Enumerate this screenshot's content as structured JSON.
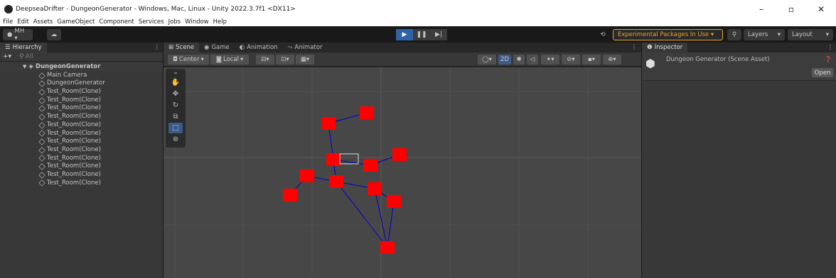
{
  "window": {
    "title": "DeepseaDrifter - DungeonGenerator - Windows, Mac, Linux - Unity 2022.3.7f1 <DX11>",
    "minimize": "–",
    "maximize": "▫",
    "close": "✕"
  },
  "menu": [
    "File",
    "Edit",
    "Assets",
    "GameObject",
    "Component",
    "Services",
    "Jobs",
    "Window",
    "Help"
  ],
  "toolbar": {
    "account": "MH ▾",
    "play": "▶",
    "pause": "❚❚",
    "step": "▶|",
    "experimental": "Experimental Packages In Use ▾",
    "layers": "Layers",
    "layout": "Layout"
  },
  "hierarchy": {
    "tab": "Hierarchy",
    "search_placeholder": "All",
    "scene": "DungeonGenerator",
    "items": [
      "Main Camera",
      "DungeonGenerator",
      "Test_Room(Clone)",
      "Test_Room(Clone)",
      "Test_Room(Clone)",
      "Test_Room(Clone)",
      "Test_Room(Clone)",
      "Test_Room(Clone)",
      "Test_Room(Clone)",
      "Test_Room(Clone)",
      "Test_Room(Clone)",
      "Test_Room(Clone)",
      "Test_Room(Clone)",
      "Test_Room(Clone)"
    ]
  },
  "scene": {
    "tabs": [
      "Scene",
      "Game",
      "Animation",
      "Animator"
    ],
    "pivot": "Center",
    "space": "Local",
    "mode_2d": "2D"
  },
  "inspector": {
    "tab": "Inspector",
    "asset_title": "Dungeon Generator (Scene Asset)",
    "open_button": "Open"
  },
  "colors": {
    "room": "#ff0000",
    "connection": "#0000cc",
    "accent": "#2e63a8",
    "warning": "#e5a22a"
  }
}
